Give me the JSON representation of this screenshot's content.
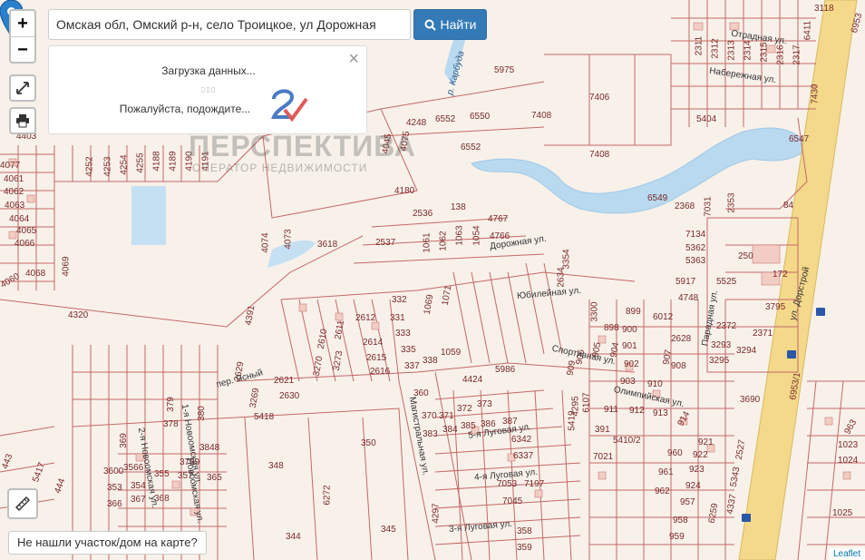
{
  "search": {
    "value": "Омская обл, Омский р-н, село Троицкое, ул Дорожная",
    "button_label": "Найти"
  },
  "loading": {
    "line1": "Загрузка данных...",
    "line2": "Пожалуйста, подождите...",
    "close": "×",
    "dots": "▯▯▯"
  },
  "controls": {
    "zoom_in": "+",
    "zoom_out": "−"
  },
  "watermark": {
    "title": "ПЕРСПЕКТИВА",
    "subtitle": "ОПЕРАТОР НЕДВИЖИМОСТИ"
  },
  "not_found_label": "Не нашли участок/дом на карте?",
  "attribution": "Leaflet",
  "map": {
    "streets": [
      "Отрадная ул.",
      "Набережная ул.",
      "Дорожная ул.",
      "Юбилейная ул.",
      "Спортивная ул.",
      "Олимпийская ул.",
      "Парадная ул.",
      "ул. Дорстрой",
      "Магистральная ул.",
      "2-я Новоомская ул.",
      "1-я Новоомская ул.",
      "Новоомская ул.",
      "3-я Луговая ул.",
      "4-я Луговая ул.",
      "5-я Луговая ул.",
      "пер. Ясный",
      "р. Карбуда"
    ],
    "parcels": [
      "3118",
      "6953",
      "2311",
      "2312",
      "2313",
      "2314",
      "2315",
      "2316",
      "2317",
      "6411",
      "7406",
      "7408",
      "7408",
      "5404",
      "6547",
      "7430",
      "5975",
      "6552",
      "6550",
      "6552",
      "4248",
      "4180",
      "2536",
      "138",
      "4767",
      "4766",
      "1054",
      "1063",
      "1062",
      "1061",
      "2537",
      "3618",
      "4074",
      "4073",
      "4069",
      "4320",
      "4060",
      "4068",
      "4066",
      "4065",
      "4064",
      "4063",
      "4062",
      "4061",
      "4077",
      "4252",
      "4253",
      "4254",
      "4255",
      "4188",
      "4189",
      "4190",
      "4191",
      "4045",
      "4075",
      "4403",
      "6549",
      "2368",
      "7031",
      "2353",
      "84",
      "7134",
      "5362",
      "5363",
      "250",
      "172",
      "5917",
      "4748",
      "5525",
      "3795",
      "2372",
      "2371",
      "3293",
      "3294",
      "3295",
      "3690",
      "6953/1",
      "4391",
      "2610",
      "2611",
      "2612",
      "331",
      "332",
      "333",
      "335",
      "337",
      "338",
      "1059",
      "1069",
      "1071",
      "2614",
      "2615",
      "2616",
      "2629",
      "3269",
      "2621",
      "2630",
      "3270",
      "3273",
      "5418",
      "5986",
      "4424",
      "360",
      "370",
      "371",
      "372",
      "373",
      "383",
      "384",
      "385",
      "386",
      "387",
      "6342",
      "6337",
      "7053",
      "7045",
      "7197",
      "7021",
      "391",
      "898",
      "899",
      "900",
      "901",
      "902",
      "903",
      "904",
      "905",
      "906",
      "907",
      "908",
      "909",
      "910",
      "911",
      "912",
      "913",
      "914",
      "921",
      "922",
      "923",
      "924",
      "957",
      "958",
      "959",
      "960",
      "961",
      "962",
      "963",
      "1023",
      "1024",
      "1025",
      "3600",
      "3566",
      "3789",
      "3848",
      "353",
      "354",
      "355",
      "357",
      "365",
      "366",
      "367",
      "368",
      "369",
      "378",
      "379",
      "380",
      "348",
      "350",
      "344",
      "345",
      "358",
      "359",
      "421",
      "5417",
      "443",
      "444",
      "6272",
      "4297",
      "4295",
      "6107",
      "5410/2",
      "5419",
      "2634",
      "3354",
      "3300",
      "6012",
      "2628",
      "2527",
      "5343",
      "4337",
      "6259",
      "3717",
      "6027",
      "6021",
      "3711"
    ]
  }
}
